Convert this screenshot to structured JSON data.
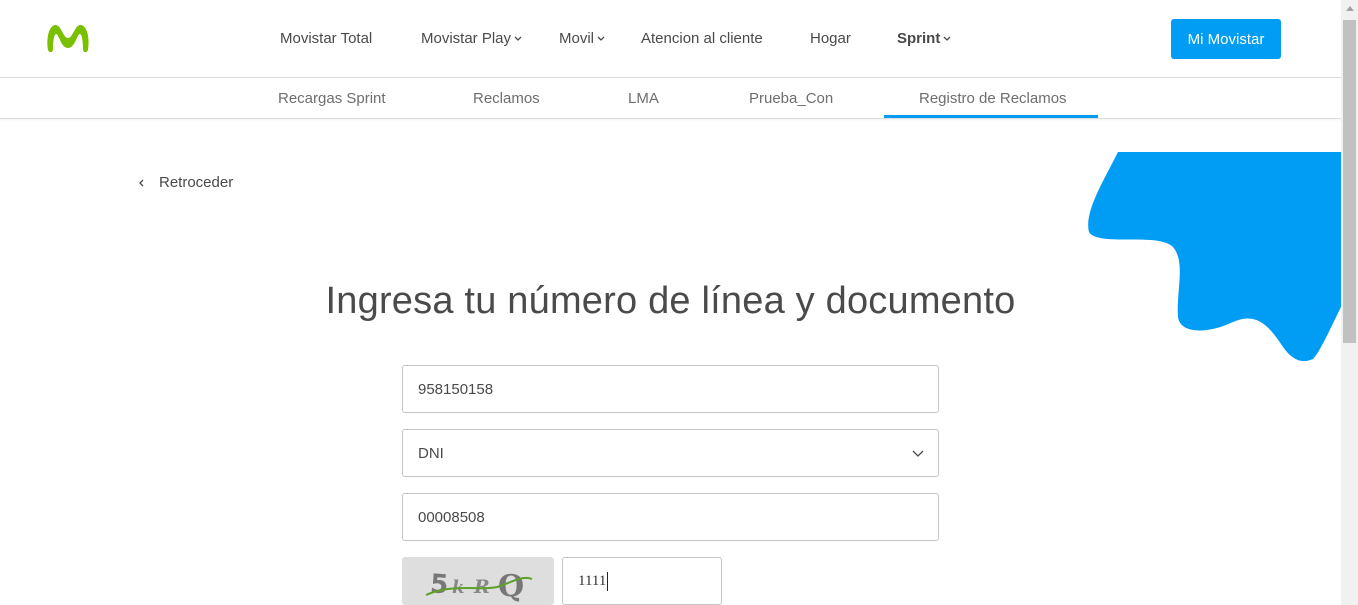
{
  "header": {
    "logo_icon": "movistar-logo-icon",
    "brand_color": "#79c000",
    "nav": [
      {
        "label": "Movistar Total",
        "dropdown": false
      },
      {
        "label": "Movistar Play",
        "dropdown": true
      },
      {
        "label": "Movil",
        "dropdown": true
      },
      {
        "label": "Atencion al cliente",
        "dropdown": false
      },
      {
        "label": "Hogar",
        "dropdown": false
      },
      {
        "label": "Sprint",
        "dropdown": true,
        "active": true
      }
    ],
    "cta_label": "Mi Movistar",
    "accent_color": "#019df4"
  },
  "subnav": {
    "items": [
      {
        "label": "Recargas Sprint"
      },
      {
        "label": "Reclamos"
      },
      {
        "label": "LMA"
      },
      {
        "label": "Prueba_Con"
      },
      {
        "label": "Registro de Reclamos",
        "active": true
      }
    ]
  },
  "back": {
    "label": "Retroceder",
    "icon": "chevron-left-icon"
  },
  "page": {
    "title": "Ingresa tu número de línea y documento"
  },
  "form": {
    "phone_value": "958150158",
    "doc_type_value": "DNI",
    "doc_number_value": "00008508",
    "captcha_text": "5kRQ",
    "captcha_input_value": "1111"
  }
}
